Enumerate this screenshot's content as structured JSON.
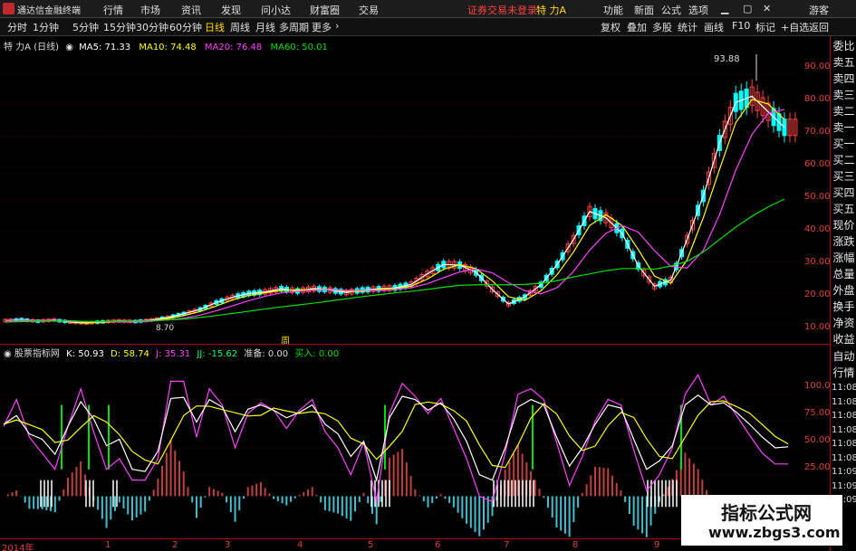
{
  "app": {
    "title": "通达信金融终端",
    "menu": [
      "行情",
      "市场",
      "资讯",
      "发现",
      "问小达",
      "财富圈",
      "交易"
    ],
    "notice": "证券交易未登录",
    "stock": "特 力A",
    "right_menu": [
      "功能",
      "新面",
      "公式",
      "选项"
    ],
    "guest": "游客"
  },
  "periods": [
    "分时",
    "1分钟",
    "5分钟",
    "15分钟",
    "30分钟",
    "60分钟",
    "日线",
    "周线",
    "月线",
    "多周期",
    "更多"
  ],
  "periods_active": "日线",
  "toolbar_right": [
    "复权",
    "叠加",
    "多股",
    "统计",
    "画线",
    "F10",
    "标记",
    "+自选",
    "返回"
  ],
  "main_header": {
    "name": "特 力A",
    "period": "(日线)",
    "ma5": "MA5: 71.33",
    "ma10": "MA10: 74.48",
    "ma20": "MA20: 76.48",
    "ma60": "MA60: 50.01"
  },
  "colors": {
    "ma5": "#ffffff",
    "ma10": "#ffff00",
    "ma20": "#ff40ff",
    "ma60": "#00e000",
    "up": "#ff4040",
    "down": "#00ffff",
    "axis": "#e04040",
    "grid": "#4a0000"
  },
  "annotations": {
    "high": "93.88",
    "low": "8.70",
    "marker": "周"
  },
  "main_yaxis": [
    "90.00",
    "80.00",
    "70.00",
    "60.00",
    "50.00",
    "40.00",
    "30.00",
    "20.00",
    "10.00"
  ],
  "kdj_header": {
    "name": "股票指标网",
    "k": "K: 50.93",
    "d": "D: 58.74",
    "j": "J: 35.31",
    "jj": "JJ: -15.62",
    "zb": "准备: 0.00",
    "mr": "买入: 0.00"
  },
  "kdj_yaxis": [
    "100.0",
    "75.00",
    "50.00",
    "25.00"
  ],
  "xaxis": [
    "2014年",
    "1",
    "2",
    "3",
    "4",
    "5",
    "6",
    "7",
    "8",
    "9"
  ],
  "side_panel": [
    "委比",
    "卖五",
    "卖四",
    "卖三",
    "卖二",
    "卖一",
    "买一",
    "买二",
    "买三",
    "买四",
    "买五",
    "现价",
    "涨跌",
    "涨幅",
    "总量",
    "外盘",
    "换手",
    "净资",
    "收益"
  ],
  "side_panel2": [
    "自动",
    "行情"
  ],
  "side_nums": [
    "11:08",
    "11:08",
    "11:08",
    "11:08",
    "11:08",
    "11:08",
    "11:09",
    "11:09",
    "11:09"
  ],
  "watermark": {
    "title": "指标公式网",
    "url": "www.zbgs3.com"
  },
  "chart_data": [
    {
      "type": "line",
      "title": "",
      "series": [
        {
          "name": "MA5",
          "values": [
            11.0,
            11.3,
            10.8,
            11.2,
            10.5,
            10.2,
            10.6,
            10.9,
            10.7,
            11.2,
            12.0,
            13.2,
            14.6,
            16.8,
            18.5,
            19.7,
            20.2,
            21.2,
            20.5,
            21.3,
            20.8,
            20.0,
            20.8,
            21.2,
            21.5,
            22.6,
            26.0,
            29.0,
            28.8,
            26.5,
            21.0,
            16.3,
            18.6,
            22.5,
            29.0,
            37.0,
            46.0,
            44.0,
            39.0,
            28.5,
            22.0,
            24.0,
            37.0,
            51.0,
            68.0,
            81.0,
            83.0,
            78.0,
            73.0
          ]
        },
        {
          "name": "MA60",
          "values": [
            10.5,
            10.7,
            10.8,
            10.9,
            10.8,
            10.7,
            10.7,
            10.8,
            10.9,
            11.0,
            11.2,
            11.5,
            12.0,
            12.6,
            13.3,
            14.0,
            14.7,
            15.4,
            16.0,
            16.6,
            17.3,
            18.0,
            18.7,
            19.3,
            19.9,
            20.4,
            21.0,
            21.7,
            22.3,
            22.5,
            22.5,
            22.5,
            22.6,
            23.0,
            23.8,
            25.0,
            26.0,
            27.0,
            27.7,
            27.7,
            27.5,
            28.5,
            30.0,
            33.0,
            37.0,
            41.0,
            44.5,
            47.5,
            50.0
          ]
        }
      ]
    },
    {
      "type": "line",
      "title": "",
      "series": [
        {
          "name": "K",
          "values": [
            72,
            80,
            63,
            58,
            44,
            70,
            93,
            77,
            52,
            58,
            30,
            28,
            47,
            96,
            97,
            74,
            95,
            88,
            65,
            86,
            90,
            85,
            78,
            83,
            90,
            72,
            63,
            42,
            56,
            20,
            78,
            98,
            95,
            85,
            92,
            77,
            56,
            25,
            20,
            50,
            88,
            95,
            90,
            60,
            33,
            50,
            72,
            90,
            87,
            58,
            30,
            38,
            52,
            90,
            99,
            90,
            92,
            83,
            72,
            60,
            50,
            51
          ]
        },
        {
          "name": "J",
          "values": [
            70,
            95,
            60,
            45,
            30,
            70,
            105,
            65,
            30,
            40,
            20,
            20,
            40,
            112,
            112,
            60,
            105,
            90,
            50,
            82,
            92,
            85,
            68,
            85,
            95,
            65,
            50,
            25,
            55,
            0,
            82,
            110,
            98,
            82,
            96,
            68,
            40,
            5,
            0,
            45,
            100,
            105,
            95,
            55,
            15,
            42,
            75,
            95,
            90,
            48,
            10,
            25,
            50,
            100,
            118,
            90,
            98,
            80,
            62,
            45,
            35,
            35
          ]
        }
      ]
    }
  ]
}
